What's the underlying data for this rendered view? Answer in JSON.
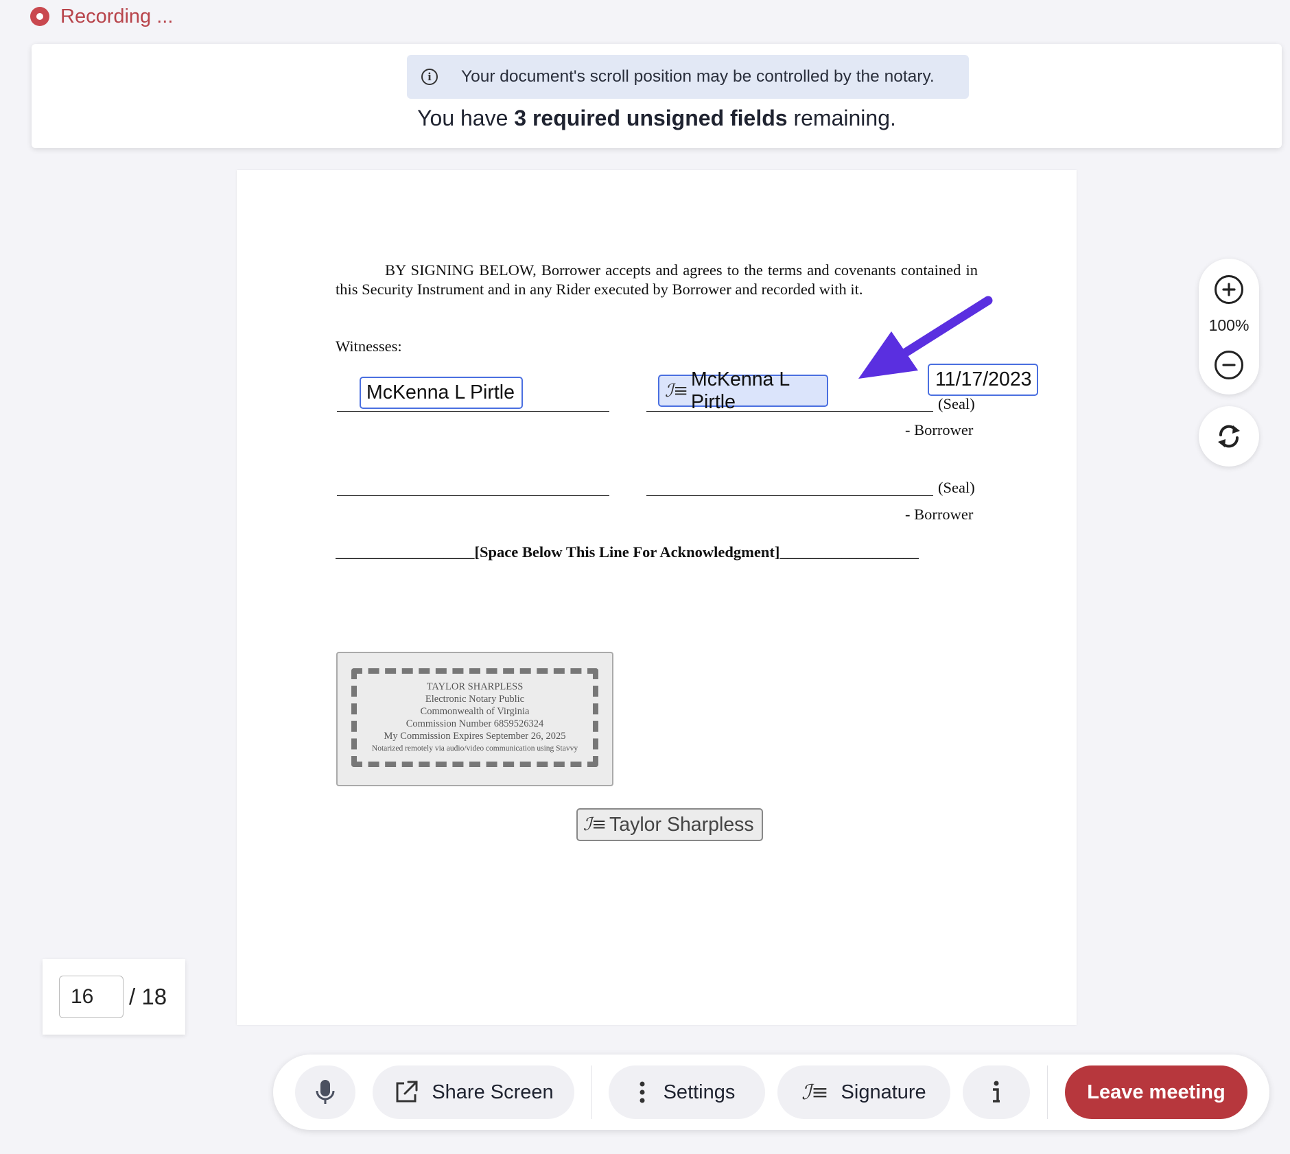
{
  "recording": {
    "label": "Recording ..."
  },
  "banner": {
    "notice": "Your document's scroll position may be controlled by the notary.",
    "remaining_prefix": "You have ",
    "remaining_bold": "3 required unsigned fields",
    "remaining_suffix": " remaining."
  },
  "document": {
    "paragraph": "BY SIGNING BELOW, Borrower accepts and agrees to the terms and covenants contained in this Security Instrument and in any Rider executed by Borrower and recorded with it.",
    "witnesses_label": "Witnesses:",
    "witness_name_field": "McKenna L Pirtle",
    "borrower_signature_field": "McKenna L Pirtle",
    "date_field": "11/17/2023",
    "seal_label_1": "(Seal)",
    "borrower_label_1": "- Borrower",
    "seal_label_2": "(Seal)",
    "borrower_label_2": "- Borrower",
    "ack_line": "__________________[Space Below This Line For Acknowledgment]__________________",
    "stamp": {
      "line1": "TAYLOR SHARPLESS",
      "line2": "Electronic Notary Public",
      "line3": "Commonwealth of Virginia",
      "line4": "Commission Number 6859526324",
      "line5": "My Commission Expires September 26, 2025",
      "line6": "Notarized remotely via audio/video communication using Stavvy"
    },
    "notary_signature_field": "Taylor Sharpless"
  },
  "zoom": {
    "level": "100%",
    "zoom_in_icon": "plus-circle-icon",
    "zoom_out_icon": "minus-circle-icon",
    "rotate_icon": "rotate-icon"
  },
  "pagination": {
    "current": "16",
    "total": "/ 18"
  },
  "toolbar": {
    "mic_icon": "microphone-icon",
    "share_label": "Share Screen",
    "settings_label": "Settings",
    "signature_label": "Signature",
    "info_icon": "info-icon",
    "leave_label": "Leave meeting"
  },
  "colors": {
    "accent": "#4a6fe0",
    "arrow": "#5a2fe0",
    "leave_button": "#b7373d",
    "recording": "#c9484f",
    "notice_background": "#e2e8f5"
  }
}
